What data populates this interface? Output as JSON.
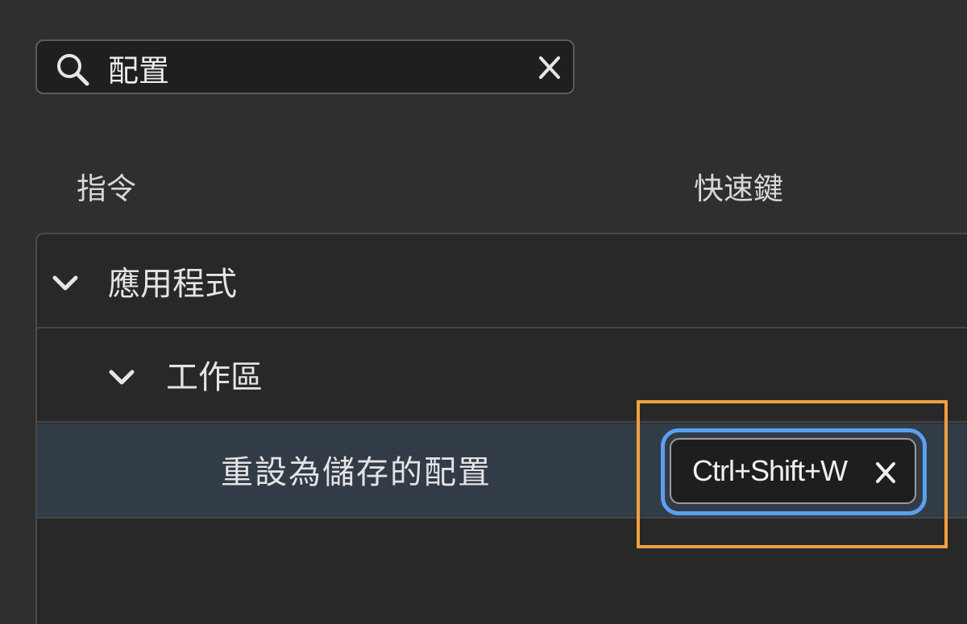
{
  "search": {
    "value": "配置",
    "icon": "search-icon",
    "clear_icon": "close-icon"
  },
  "columns": {
    "command": "指令",
    "shortcut": "快速鍵"
  },
  "tree": {
    "group": {
      "label": "應用程式",
      "icon": "chevron-down-icon",
      "expanded": true
    },
    "subgroup": {
      "label": "工作區",
      "icon": "chevron-down-icon",
      "expanded": true
    },
    "command": {
      "label": "重設為儲存的配置",
      "shortcut": "Ctrl+Shift+W",
      "remove_icon": "close-icon",
      "selected": true
    }
  },
  "colors": {
    "background": "#2f2f2f",
    "selected_row": "#323c47",
    "focus_ring": "#5aa0f0",
    "highlight_annotation": "#f0a040"
  }
}
